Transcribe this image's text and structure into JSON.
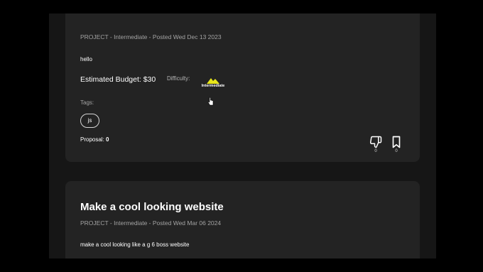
{
  "cards": [
    {
      "meta": "PROJECT - Intermediate - Posted Wed Dec 13 2023",
      "description": "hello",
      "budget": "Estimated Budget: $30",
      "difficulty_label": "Difficulty:",
      "difficulty_value": "Intermediate",
      "tags_label": "Tags:",
      "tags": [
        "js"
      ],
      "proposal_label": "Proposal:",
      "proposal_count": "0",
      "dislike_count": "0",
      "bookmark_count": "0"
    },
    {
      "title": "Make a cool looking website",
      "meta": "PROJECT - Intermediate - Posted Wed Mar 06 2024",
      "description": "make a cool looking like a g 6 boss website"
    }
  ],
  "colors": {
    "background": "#000000",
    "page": "#161616",
    "card": "#232323",
    "accent_difficulty": "#e8e61a"
  },
  "icons": [
    "mountain-icon",
    "thumbs-down-icon",
    "bookmark-icon",
    "cursor-icon"
  ]
}
